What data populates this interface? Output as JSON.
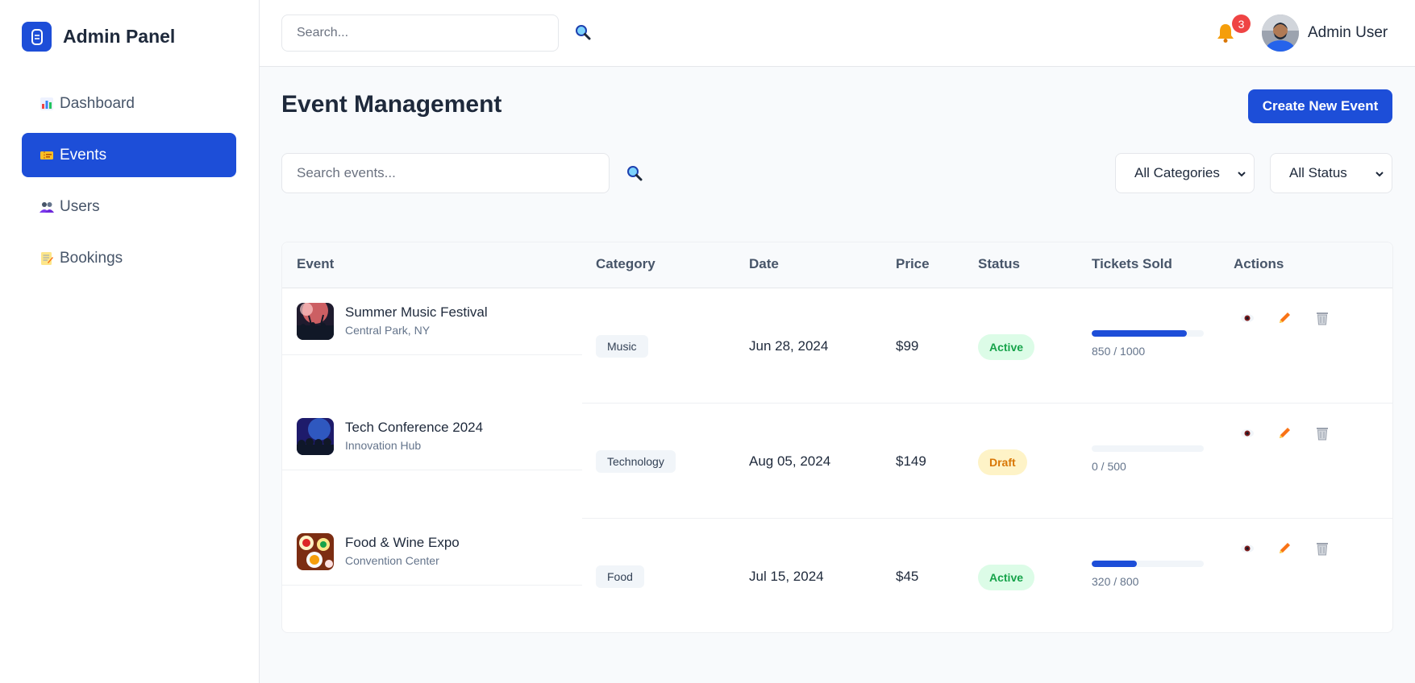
{
  "sidebar": {
    "brand_title": "Admin Panel",
    "items": [
      {
        "label": "Dashboard",
        "icon": "bar-chart-icon",
        "active": false
      },
      {
        "label": "Events",
        "icon": "ticket-icon",
        "active": true
      },
      {
        "label": "Users",
        "icon": "users-icon",
        "active": false
      },
      {
        "label": "Bookings",
        "icon": "memo-icon",
        "active": false
      }
    ]
  },
  "header": {
    "search_placeholder": "Search...",
    "notification_count": "3",
    "user_name": "Admin User"
  },
  "main": {
    "title": "Event Management",
    "create_button": "Create New Event",
    "event_search_placeholder": "Search events...",
    "category_filter": "All Categories",
    "status_filter": "All Status"
  },
  "table": {
    "columns": [
      "Event",
      "Category",
      "Date",
      "Price",
      "Status",
      "Tickets Sold",
      "Actions"
    ],
    "rows": [
      {
        "name": "Summer Music Festival",
        "location": "Central Park, NY",
        "category": "Music",
        "date": "Jun 28, 2024",
        "price": "$99",
        "status": "Active",
        "tickets": "850 / 1000",
        "sold_fraction": 0.85
      },
      {
        "name": "Tech Conference 2024",
        "location": "Innovation Hub",
        "category": "Technology",
        "date": "Aug 05, 2024",
        "price": "$149",
        "status": "Draft",
        "tickets": "0 / 500",
        "sold_fraction": 0
      },
      {
        "name": "Food & Wine Expo",
        "location": "Convention Center",
        "category": "Food",
        "date": "Jul 15, 2024",
        "price": "$45",
        "status": "Active",
        "tickets": "320 / 800",
        "sold_fraction": 0.4
      }
    ]
  },
  "colors": {
    "primary": "#1d4ed8",
    "active_bg": "#dcfce7",
    "active_text": "#16a34a",
    "draft_bg": "#fef3c7",
    "draft_text": "#d97706",
    "badge": "#ef4444"
  }
}
